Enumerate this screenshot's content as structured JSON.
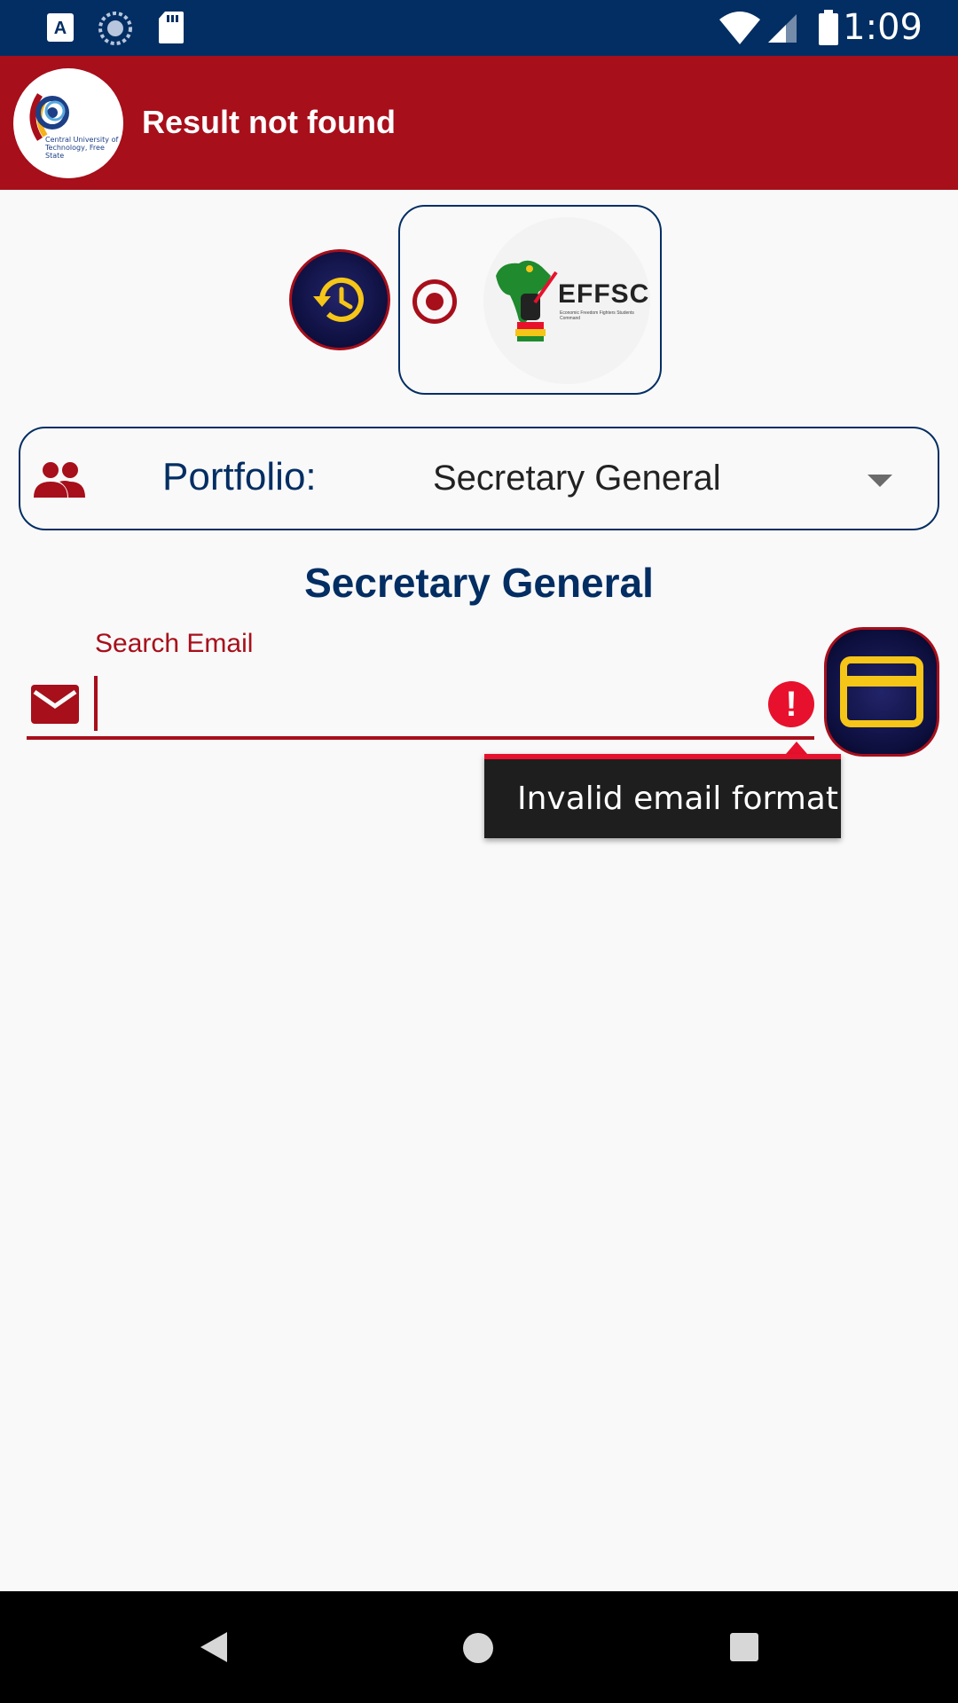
{
  "status_bar": {
    "time": "1:09",
    "icons": [
      "keyboard-a-icon",
      "sync-icon",
      "sd-card-icon",
      "wifi-icon",
      "signal-icon",
      "battery-icon"
    ]
  },
  "app_bar": {
    "title": "Result not found",
    "logo_caption": "Central University of Technology, Free State"
  },
  "selector": {
    "logo_text": "EFFSC",
    "logo_subtext": "Economic Freedom Fighters Students Command"
  },
  "portfolio": {
    "label": "Portfolio:",
    "value": "Secretary General"
  },
  "section_title": "Secretary General",
  "email_field": {
    "label": "Search Email",
    "value": "",
    "error": "Invalid email format"
  },
  "colors": {
    "status_bar": "#032e63",
    "app_bar": "#a70f1b",
    "navy": "#032e63",
    "error": "#e8112d",
    "gold": "#f5c518"
  }
}
